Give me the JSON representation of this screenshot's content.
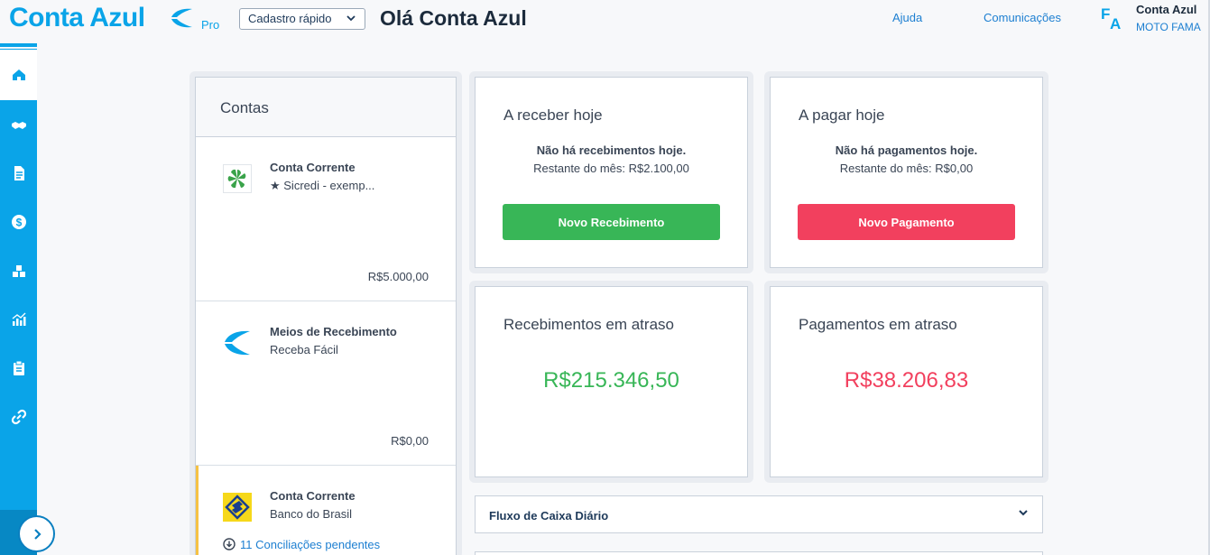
{
  "header": {
    "logo_text": "Conta Azul",
    "logo_badge": "Pro",
    "quick_register": "Cadastro rápido",
    "greeting": "Olá Conta Azul",
    "help": "Ajuda",
    "communications": "Comunicações",
    "avatar_initials": {
      "first": "F",
      "second": "A"
    },
    "user_name": "Conta Azul",
    "company": "MOTO FAMA"
  },
  "sidebar": {
    "items": [
      {
        "icon": "home-icon",
        "active": true
      },
      {
        "icon": "handshake-icon",
        "active": false
      },
      {
        "icon": "document-icon",
        "active": false
      },
      {
        "icon": "dollar-icon",
        "active": false
      },
      {
        "icon": "boxes-icon",
        "active": false
      },
      {
        "icon": "chart-icon",
        "active": false
      },
      {
        "icon": "clipboard-icon",
        "active": false
      },
      {
        "icon": "link-icon",
        "active": false
      }
    ],
    "expand_icon": "chevron-right-icon"
  },
  "accounts": {
    "title": "Contas",
    "items": [
      {
        "name": "Conta Corrente",
        "sub": "★ Sicredi - exemp...",
        "balance": "R$5.000,00",
        "icon": "sicredi-logo"
      },
      {
        "name": "Meios de Recebimento",
        "sub": "Receba Fácil",
        "balance": "R$0,00",
        "icon": "conta-azul-logo"
      },
      {
        "name": "Conta Corrente",
        "sub": "Banco do Brasil",
        "pending": "11 Conciliações pendentes",
        "icon": "banco-do-brasil-logo"
      }
    ]
  },
  "receive_today": {
    "title": "A receber hoje",
    "message": "Não há recebimentos hoje.",
    "remaining": "Restante do mês: R$2.100,00",
    "button": "Novo Recebimento"
  },
  "pay_today": {
    "title": "A pagar hoje",
    "message": "Não há pagamentos hoje.",
    "remaining": "Restante do mês: R$0,00",
    "button": "Novo Pagamento"
  },
  "overdue_receipts": {
    "title": "Recebimentos em atraso",
    "value": "R$215.346,50"
  },
  "overdue_payments": {
    "title": "Pagamentos em atraso",
    "value": "R$38.206,83"
  },
  "cash_flow": {
    "title": "Fluxo de Caixa Diário"
  },
  "colors": {
    "brand": "#0aa4e8",
    "positive": "#38b657",
    "negative": "#f2405e"
  }
}
